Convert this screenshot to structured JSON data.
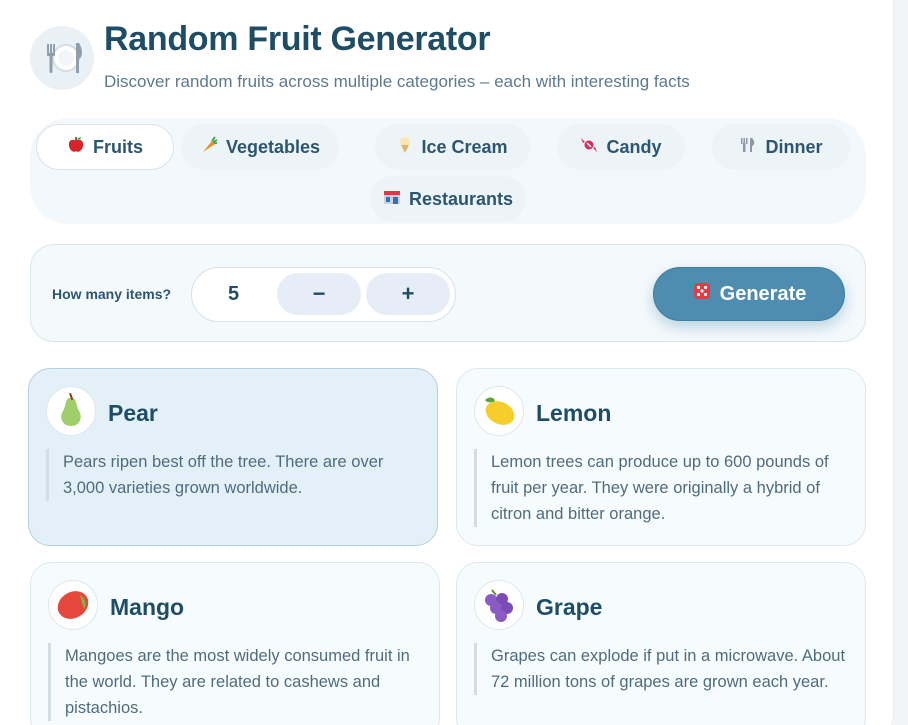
{
  "header": {
    "title": "Random Fruit Generator",
    "subtitle": "Discover random fruits across multiple categories – each with interesting facts",
    "icon": "fork-knife-plate-icon"
  },
  "tabs": [
    {
      "label": "Fruits",
      "icon": "apple-icon",
      "active": true
    },
    {
      "label": "Vegetables",
      "icon": "carrot-icon",
      "active": false
    },
    {
      "label": "Ice Cream",
      "icon": "ice-cream-icon",
      "active": false
    },
    {
      "label": "Candy",
      "icon": "candy-icon",
      "active": false
    },
    {
      "label": "Dinner",
      "icon": "fork-knife-icon",
      "active": false
    },
    {
      "label": "Restaurants",
      "icon": "restaurant-icon",
      "active": false
    }
  ],
  "controls": {
    "count_label": "How many items?",
    "count_value": "5",
    "decrement_label": "−",
    "increment_label": "+",
    "generate_label": "Generate",
    "generate_icon": "dice-icon"
  },
  "results": [
    {
      "name": "Pear",
      "icon": "pear-icon",
      "selected": true,
      "fact": "Pears ripen best off the tree. There are over 3,000 varieties grown worldwide."
    },
    {
      "name": "Lemon",
      "icon": "lemon-icon",
      "selected": false,
      "fact": "Lemon trees can produce up to 600 pounds of fruit per year. They were originally a hybrid of citron and bitter orange."
    },
    {
      "name": "Mango",
      "icon": "mango-icon",
      "selected": false,
      "fact": "Mangoes are the most widely consumed fruit in the world. They are related to cashews and pistachios."
    },
    {
      "name": "Grape",
      "icon": "grape-icon",
      "selected": false,
      "fact": "Grapes can explode if put in a microwave. About 72 million tons of grapes are grown each year."
    }
  ],
  "colors": {
    "accent": "#4f8db0",
    "title": "#1f4d66",
    "selected_card": "#e4f0f8"
  }
}
